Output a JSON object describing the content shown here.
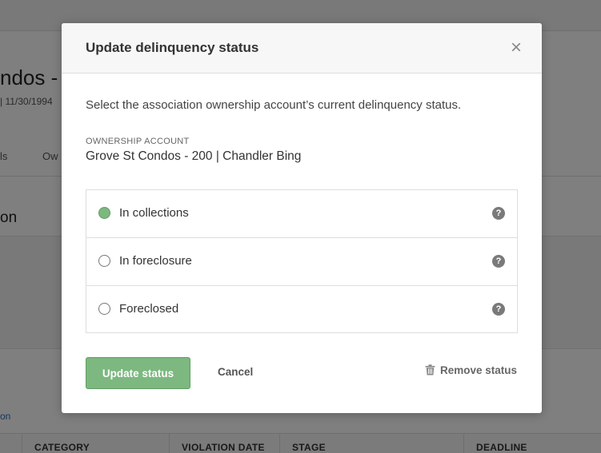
{
  "background": {
    "title": "ndos - ",
    "subtitle": "| 11/30/1994",
    "tabs": [
      "ls",
      "Ow"
    ],
    "section_title": "on",
    "link_text": "on",
    "table_headers": [
      "CATEGORY",
      "VIOLATION DATE",
      "STAGE",
      "DEADLINE"
    ]
  },
  "modal": {
    "title": "Update delinquency status",
    "close_glyph": "×",
    "description": "Select the association ownership account’s current delinquency status.",
    "account_label": "OWNERSHIP ACCOUNT",
    "account_value": "Grove St Condos - 200 | Chandler Bing",
    "options": [
      {
        "label": "In collections",
        "selected": true,
        "help_glyph": "?"
      },
      {
        "label": "In foreclosure",
        "selected": false,
        "help_glyph": "?"
      },
      {
        "label": "Foreclosed",
        "selected": false,
        "help_glyph": "?"
      }
    ],
    "update_label": "Update status",
    "cancel_label": "Cancel",
    "remove_label": "Remove status"
  },
  "colors": {
    "accent_green": "#7cb87f",
    "overlay": "rgba(0,0,0,0.5)"
  }
}
